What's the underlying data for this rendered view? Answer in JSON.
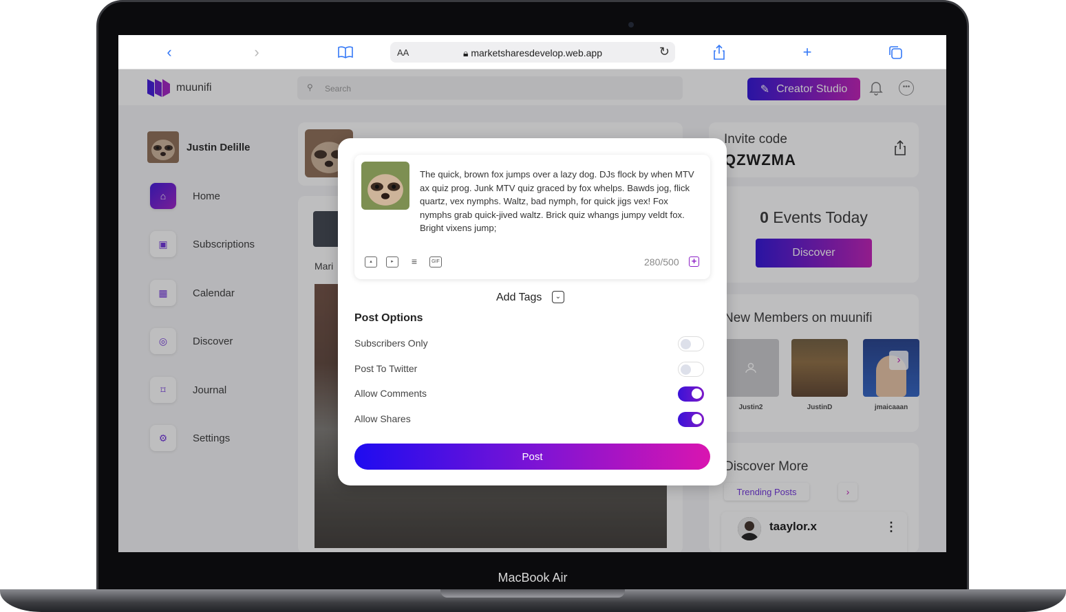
{
  "device": {
    "label": "MacBook Air"
  },
  "browser": {
    "url_prefix": "AA",
    "url": "marketsharesdevelop.web.app"
  },
  "app": {
    "logo_text": "muunifi",
    "search_placeholder": "Search",
    "creator_button": "Creator Studio"
  },
  "sidebar": {
    "profile_name": "Justin Delille",
    "items": [
      {
        "label": "Home",
        "icon": "home-icon"
      },
      {
        "label": "Subscriptions",
        "icon": "ticket-icon"
      },
      {
        "label": "Calendar",
        "icon": "calendar-icon"
      },
      {
        "label": "Discover",
        "icon": "compass-icon"
      },
      {
        "label": "Journal",
        "icon": "bookmark-icon"
      },
      {
        "label": "Settings",
        "icon": "gear-icon"
      }
    ]
  },
  "feed": {
    "post_author": "Mari"
  },
  "right": {
    "invite_label": "Invite code",
    "invite_code": "QZWZMA",
    "events_count": "0",
    "events_label": "Events Today",
    "discover_button": "Discover",
    "members_title": "New Members on muunifi",
    "members": [
      {
        "name": "Justin2"
      },
      {
        "name": "JustinD"
      },
      {
        "name": "jmaicaaan"
      }
    ],
    "discover_more_title": "Discover More",
    "trending_label": "Trending Posts",
    "trending_user": "taaylor.x"
  },
  "modal": {
    "composer_text": "The quick, brown fox jumps over a lazy dog. DJs flock by when MTV ax quiz prog. Junk MTV quiz graced by fox whelps. Bawds jog, flick quartz, vex nymphs. Waltz, bad nymph, for quick jigs vex! Fox nymphs grab quick-jived waltz. Brick quiz whangs jumpy veldt fox. Bright vixens jump;",
    "char_count": "280/500",
    "gif_label": "GIF",
    "add_tags": "Add Tags",
    "post_options_title": "Post Options",
    "options": [
      {
        "label": "Subscribers Only",
        "enabled": false
      },
      {
        "label": "Post To Twitter",
        "enabled": false
      },
      {
        "label": "Allow Comments",
        "enabled": true
      },
      {
        "label": "Allow Shares",
        "enabled": true
      }
    ],
    "post_button": "Post"
  },
  "colors": {
    "accent_start": "#2b0cd6",
    "accent_end": "#c018b6"
  }
}
